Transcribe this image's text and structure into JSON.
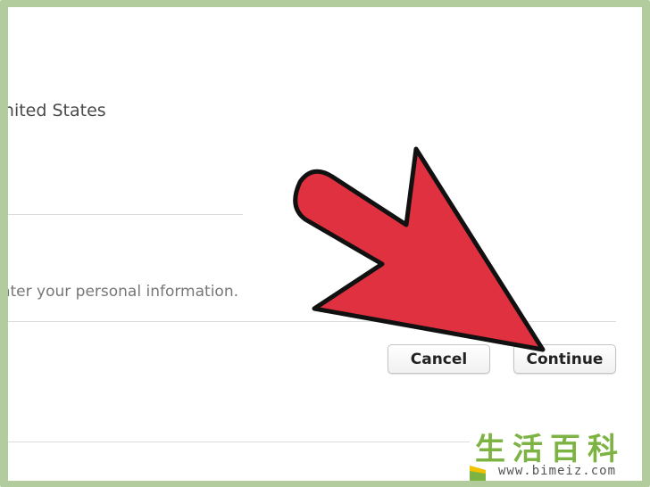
{
  "form": {
    "country_value": "United States",
    "info_text": "Enter your personal information."
  },
  "actions": {
    "cancel_label": "Cancel",
    "continue_label": "Continue"
  },
  "overlay": {
    "arrow_color": "#e03140",
    "frame_color": "#b3cc9e"
  },
  "watermark": {
    "brand_text": "生活百科",
    "url": "www.bimeiz.com"
  }
}
